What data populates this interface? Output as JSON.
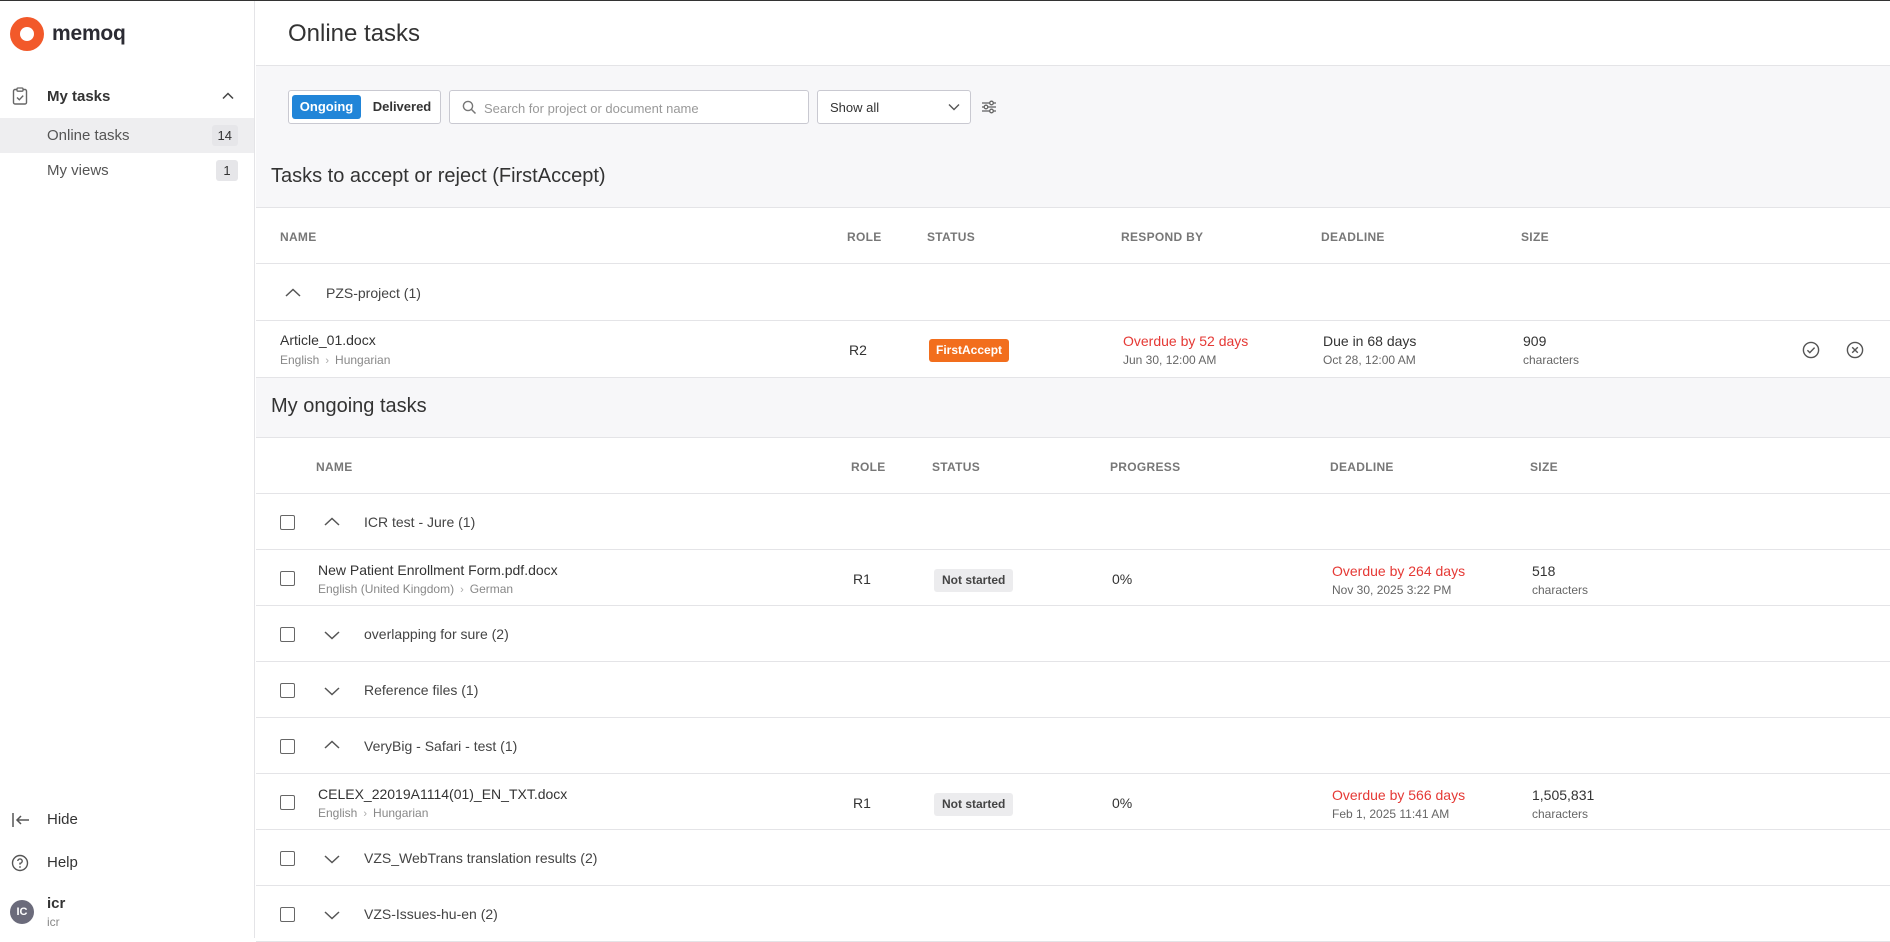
{
  "app": {
    "brand": "memoq",
    "brand_color": "#f2592a",
    "accent_color": "#2185d8"
  },
  "sidebar": {
    "group": {
      "label": "My tasks",
      "icon": "clipboard-check-icon"
    },
    "items": [
      {
        "label": "Online tasks",
        "count": "14",
        "active": true
      },
      {
        "label": "My views",
        "count": "1",
        "active": false
      }
    ],
    "hide_label": "Hide",
    "help_label": "Help",
    "user": {
      "initials": "IC",
      "name": "icr",
      "sub": "icr"
    }
  },
  "header": {
    "title": "Online tasks"
  },
  "toolbar": {
    "seg_ongoing": "Ongoing",
    "seg_delivered": "Delivered",
    "search_placeholder": "Search for project or document name",
    "filter_value": "Show all"
  },
  "accept_section": {
    "title": "Tasks to accept or reject (FirstAccept)",
    "columns": {
      "name": "NAME",
      "role": "ROLE",
      "status": "STATUS",
      "respond_by": "RESPOND BY",
      "deadline": "DEADLINE",
      "size": "SIZE"
    },
    "group": "PZS-project (1)",
    "task": {
      "name": "Article_01.docx",
      "src_lang": "English",
      "tgt_lang": "Hungarian",
      "role": "R2",
      "status": "FirstAccept",
      "respond_by": "Overdue by 52 days",
      "respond_by_date": "Jun 30, 12:00 AM",
      "deadline": "Due in 68 days",
      "deadline_date": "Oct 28, 12:00 AM",
      "size": "909",
      "size_unit": "characters"
    }
  },
  "ongoing_section": {
    "title": "My ongoing tasks",
    "columns": {
      "name": "NAME",
      "role": "ROLE",
      "status": "STATUS",
      "progress": "PROGRESS",
      "deadline": "DEADLINE",
      "size": "SIZE"
    },
    "rows": [
      {
        "kind": "group",
        "label": "ICR test - Jure (1)",
        "expanded": true
      },
      {
        "kind": "task",
        "name": "New Patient Enrollment Form.pdf.docx",
        "src_lang": "English (United Kingdom)",
        "tgt_lang": "German",
        "role": "R1",
        "status": "Not started",
        "progress": "0%",
        "deadline": "Overdue by 264 days",
        "deadline_date": "Nov 30, 2025 3:22 PM",
        "size": "518",
        "size_unit": "characters"
      },
      {
        "kind": "group",
        "label": "overlapping for sure (2)",
        "expanded": false
      },
      {
        "kind": "group",
        "label": "Reference files (1)",
        "expanded": false
      },
      {
        "kind": "group",
        "label": "VeryBig - Safari - test (1)",
        "expanded": true
      },
      {
        "kind": "task",
        "name": "CELEX_22019A1114(01)_EN_TXT.docx",
        "src_lang": "English",
        "tgt_lang": "Hungarian",
        "role": "R1",
        "status": "Not started",
        "progress": "0%",
        "deadline": "Overdue by 566 days",
        "deadline_date": "Feb 1, 2025 11:41 AM",
        "size": "1,505,831",
        "size_unit": "characters"
      },
      {
        "kind": "group",
        "label": "VZS_WebTrans translation results (2)",
        "expanded": false
      },
      {
        "kind": "group",
        "label": "VZS-Issues-hu-en (2)",
        "expanded": false
      }
    ]
  }
}
